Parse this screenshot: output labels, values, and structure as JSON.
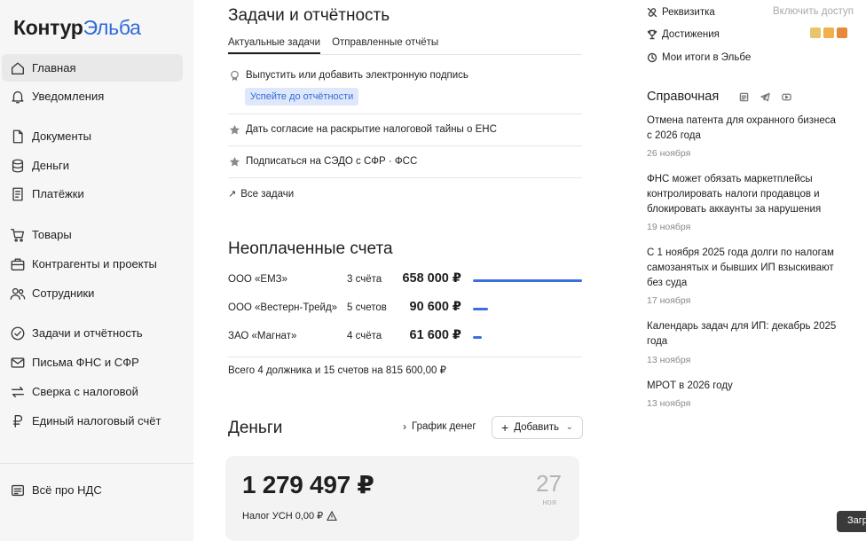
{
  "logo": {
    "part1": "Контур",
    "part2": "Эльба"
  },
  "sidebar": {
    "items": [
      {
        "label": "Главная",
        "icon": "home-icon",
        "active": true
      },
      {
        "label": "Уведомления",
        "icon": "bell-icon"
      },
      {
        "label": "Документы",
        "icon": "document-icon"
      },
      {
        "label": "Деньги",
        "icon": "coins-icon"
      },
      {
        "label": "Платёжки",
        "icon": "receipt-icon"
      },
      {
        "label": "Товары",
        "icon": "cart-icon"
      },
      {
        "label": "Контрагенты и проекты",
        "icon": "briefcase-icon"
      },
      {
        "label": "Сотрудники",
        "icon": "people-icon"
      },
      {
        "label": "Задачи и отчётность",
        "icon": "check-circle-icon"
      },
      {
        "label": "Письма ФНС и СФР",
        "icon": "mail-icon"
      },
      {
        "label": "Сверка с налоговой",
        "icon": "swap-icon"
      },
      {
        "label": "Единый налоговый счёт",
        "icon": "ruble-icon"
      },
      {
        "label": "Всё про НДС",
        "icon": "book-icon"
      }
    ]
  },
  "tasks": {
    "title": "Задачи и отчётность",
    "tabs": [
      {
        "label": "Актуальные задачи",
        "active": true
      },
      {
        "label": "Отправленные отчёты"
      }
    ],
    "items": [
      {
        "text": "Выпустить или добавить электронную подпись",
        "icon": "certificate-icon"
      },
      {
        "text": "Дать согласие на раскрытие налоговой тайны о ЕНС",
        "icon": "star-icon"
      },
      {
        "text": "Подписаться на СЭДО с СФР · ФСС",
        "icon": "star-icon"
      }
    ],
    "report_button": "Успейте до отчётности",
    "all_link": "Все задачи"
  },
  "unpaid": {
    "title": "Неоплаченные счета",
    "rows": [
      {
        "name": "ООО «ЕМЗ»",
        "count": "3 счёта",
        "amount": "658 000 ₽",
        "share": 1.0
      },
      {
        "name": "ООО «Вестерн-Трейд»",
        "count": "5 счетов",
        "amount": "90 600 ₽",
        "share": 0.14
      },
      {
        "name": "ЗАО «Магнат»",
        "count": "4 счёта",
        "amount": "61 600 ₽",
        "share": 0.08
      }
    ],
    "total": "Всего 4 должника и 15 счетов на 815 600,00 ₽"
  },
  "money": {
    "title": "Деньги",
    "chart_link": "График денег",
    "add_button": "Добавить",
    "balance": "1 279 497 ₽",
    "tax": "Налог УСН 0,00 ₽",
    "day": "27",
    "month": "ноя"
  },
  "right": {
    "links": [
      {
        "label": "Реквизитка",
        "icon": "link-off-icon"
      },
      {
        "label": "Достижения",
        "icon": "trophy-icon"
      },
      {
        "label": "Мои итоги в Эльбе",
        "icon": "clock-icon"
      }
    ],
    "enable": "Включить доступ",
    "reference": {
      "title": "Справочная",
      "news": [
        {
          "text": "Отмена патента для охранного бизнеса с 2026 года",
          "date": "26 ноября"
        },
        {
          "text": "ФНС может обязать маркетплейсы контролировать налоги продавцов и блокировать аккаунты за нарушения",
          "date": "19 ноября"
        },
        {
          "text": "С 1 ноября 2025 года долги по налогам самозанятых и бывших ИП взыскивают без суда",
          "date": "17 ноября"
        },
        {
          "text": "Календарь задач для ИП: декабрь 2025 года",
          "date": "13 ноября"
        },
        {
          "text": "МРОТ в 2026 году",
          "date": "13 ноября"
        }
      ]
    }
  },
  "toast": "Загр"
}
